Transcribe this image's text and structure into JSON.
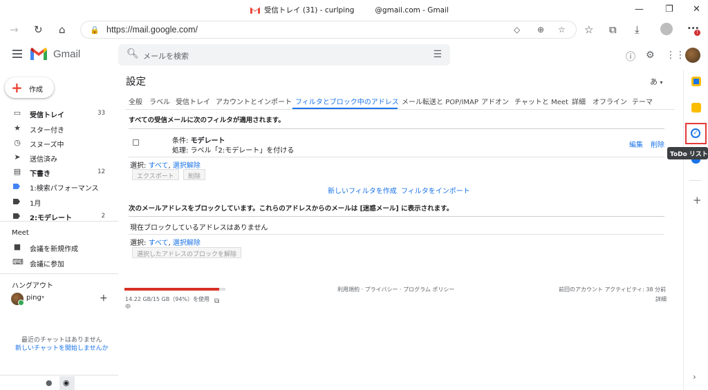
{
  "window": {
    "title_left": "受信トレイ (31) - curlping",
    "title_right": "@gmail.com - Gmail"
  },
  "browser": {
    "url": "https://mail.google.com/"
  },
  "header": {
    "app_name": "Gmail",
    "search_placeholder": "メールを検索"
  },
  "sidebar": {
    "compose_label": "作成",
    "items": [
      {
        "label": "受信トレイ",
        "count": "33",
        "icon": "inbox-icon",
        "bold": true
      },
      {
        "label": "スター付き",
        "count": "",
        "icon": "star-icon"
      },
      {
        "label": "スヌーズ中",
        "count": "",
        "icon": "clock-icon"
      },
      {
        "label": "送信済み",
        "count": "",
        "icon": "send-icon"
      },
      {
        "label": "下書き",
        "count": "12",
        "icon": "draft-icon",
        "bold": true
      },
      {
        "label": "1:検索パフォーマンス",
        "count": "",
        "icon": "label-icon"
      },
      {
        "label": "1月",
        "count": "",
        "icon": "label-icon"
      },
      {
        "label": "2:モデレート",
        "count": "2",
        "icon": "label-icon",
        "bold": true
      }
    ],
    "meet_heading": "Meet",
    "meet_new": "会議を新規作成",
    "meet_join": "会議に参加",
    "hangouts_heading": "ハングアウト",
    "hangouts_user": "ping",
    "no_chats": "最近のチャットはありません",
    "start_chat": "新しいチャットを開始しませんか"
  },
  "settings": {
    "title": "設定",
    "lang": "あ",
    "tabs": [
      "全般",
      "ラベル",
      "受信トレイ",
      "アカウントとインポート",
      "フィルタとブロック中のアドレス",
      "メール転送と POP/IMAP",
      "アドオン",
      "チャットと Meet",
      "詳細",
      "オフライン",
      "テーマ"
    ],
    "active_tab": "フィルタとブロック中のアドレス",
    "filters_heading": "すべての受信メールに次のフィルタが適用されます。",
    "filter_condition_label": "条件: ",
    "filter_condition_value": "モデレート",
    "filter_action": "処理: ラベル「2:モデレート」を付ける",
    "edit": "編集",
    "delete": "削除",
    "select_label": "選択: ",
    "select_all": "すべて",
    "select_sep": ", ",
    "select_none": "選択解除",
    "export_btn": "エクスポート",
    "delete_btn": "削除",
    "new_filter": "新しいフィルタを作成",
    "import_filter": "フィルタをインポート",
    "block_heading": "次のメールアドレスをブロックしています。これらのアドレスからのメールは [迷惑メール] に表示されます。",
    "no_blocked": "現在ブロックしているアドレスはありません",
    "unblock_btn": "選択したアドレスのブロックを解除"
  },
  "footer": {
    "storage_text": "14.22 GB/15 GB（94%）を使用",
    "storage_text2": "中",
    "storage_fraction": 0.94,
    "terms": "利用規約 · プライバシー · プログラム ポリシー",
    "last_activity": "前回のアカウント アクティビティ: 38 分前",
    "details": "詳細"
  },
  "rail": {
    "tooltip": "ToDo リスト"
  },
  "colors": {
    "accent": "#1a73e8",
    "highlight": "#e53935"
  }
}
